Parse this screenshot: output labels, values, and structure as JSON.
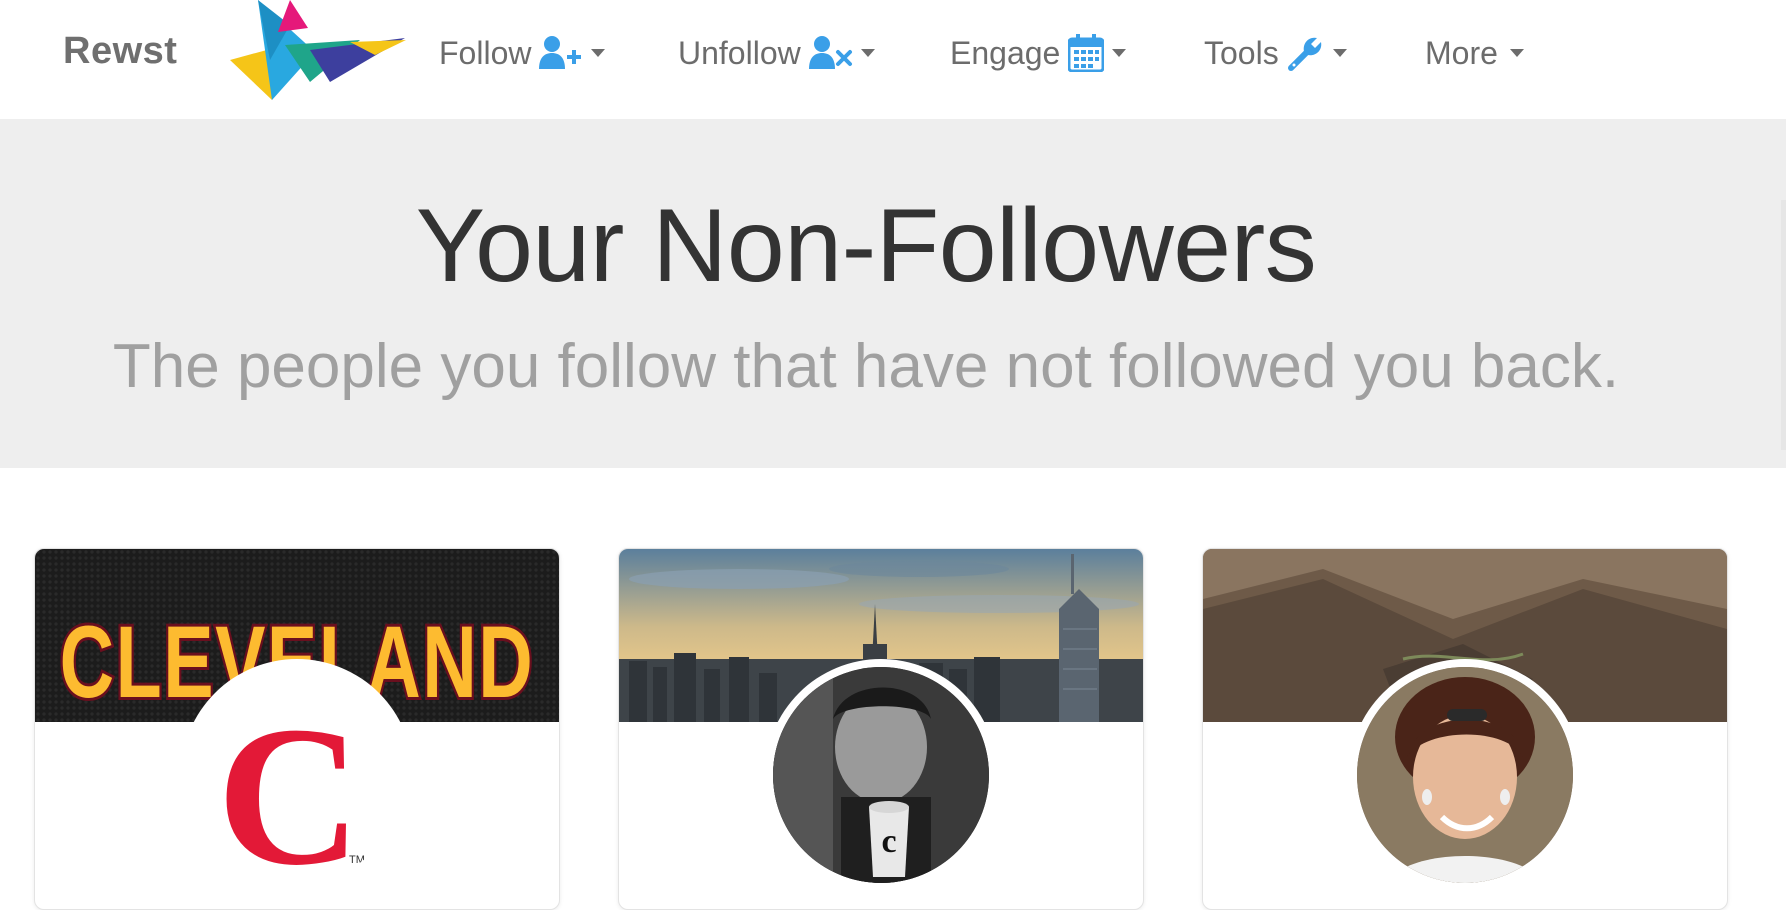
{
  "brand": {
    "name": "Rewst"
  },
  "nav": {
    "items": [
      {
        "label": "Follow",
        "icon": "user-plus-icon"
      },
      {
        "label": "Unfollow",
        "icon": "user-times-icon"
      },
      {
        "label": "Engage",
        "icon": "calendar-icon"
      },
      {
        "label": "Tools",
        "icon": "wrench-icon"
      },
      {
        "label": "More",
        "icon": ""
      }
    ]
  },
  "hero": {
    "title": "Your Non-Followers",
    "subtitle": "The people you follow that have not followed you back."
  },
  "cards": [
    {
      "banner_text": "CLEVELAND",
      "avatar_text": "C",
      "avatar_tm": "TM"
    },
    {
      "banner_text": "",
      "avatar_text": "c"
    },
    {
      "banner_text": "",
      "avatar_text": ""
    }
  ],
  "colors": {
    "accent": "#3a9fe8",
    "nav_text": "#6c6c6c",
    "hero_bg": "#eeeeee",
    "cleveland_red": "#e31937",
    "cleveland_gold": "#fdbb30"
  }
}
